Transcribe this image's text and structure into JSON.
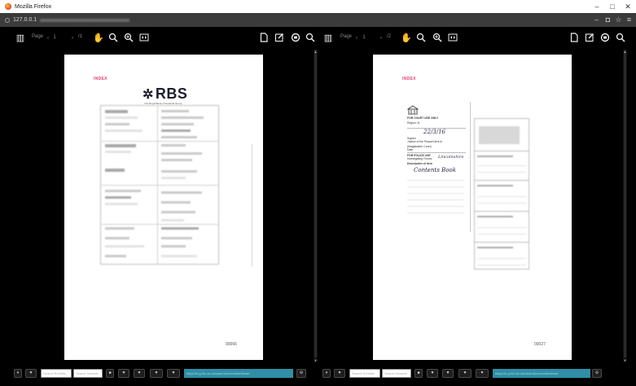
{
  "window": {
    "title": "Mozilla Firefox",
    "controls": {
      "minimize": "–",
      "maximize": "□",
      "close": "✕"
    }
  },
  "urlbar": {
    "url": "127.0.0.1",
    "icons": [
      "minus-icon",
      "shield-icon",
      "star-icon",
      "menu-icon"
    ]
  },
  "viewers": [
    {
      "toolbar": {
        "page_label": "Page",
        "current_page": "1",
        "page_total": "/1",
        "icons": [
          "sidebar-toggle-icon",
          "chevron-up-icon",
          "chevron-down-icon",
          "hand-tool-icon",
          "zoom-out-icon",
          "zoom-in-icon",
          "fit-page-icon",
          "open-file-icon",
          "edit-icon",
          "print-icon",
          "search-icon"
        ]
      },
      "page": {
        "index_stamp": "INDEX",
        "brand": "RBS",
        "brand_sub": "The Royal Bank of Scotland Group",
        "page_number": "00066"
      }
    },
    {
      "toolbar": {
        "page_label": "Page",
        "current_page": "1",
        "page_total": "/2",
        "icons": [
          "sidebar-toggle-icon",
          "chevron-up-icon",
          "chevron-down-icon",
          "hand-tool-icon",
          "zoom-out-icon",
          "zoom-in-icon",
          "fit-page-icon",
          "open-file-icon",
          "edit-icon",
          "print-icon",
          "search-icon"
        ]
      },
      "page": {
        "index_stamp": "INDEX",
        "court_title": "FOR COURT USE ONLY",
        "region": "Region: N",
        "date_hw": "22/3/16",
        "signed": "Signed",
        "justice": "Justice of the Peace/Clerk to",
        "magistrates": "(Magistrates' Court)",
        "date_label": "Date",
        "police_title": "FOR POLICE USE",
        "investigating": "Investigating Forces",
        "description": "Description of item",
        "hw_item": "Contents Book",
        "hw_force": "Lincolnshire",
        "page_number": "00027"
      }
    }
  ],
  "bottombar": {
    "filter_placeholder": "Search Exhibits",
    "search_placeholder": "Search Number",
    "buttons": [
      "▼",
      "▼",
      "▼",
      "▼",
      "▼"
    ],
    "url_text": "https://e.g.hrc.ac.uk/case/documents/viewer"
  }
}
